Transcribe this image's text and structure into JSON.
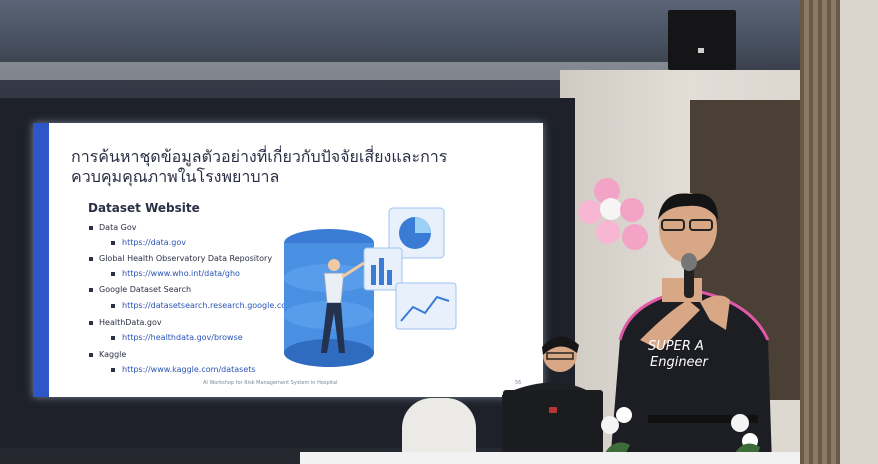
{
  "slide": {
    "title_line1": "การค้นหาชุดข้อมูลตัวอย่างที่เกี่ยวกับปัจจัยเสี่ยงและการ",
    "title_line2": "ควบคุมคุณภาพในโรงพยาบาล",
    "heading": "Dataset Website",
    "items": [
      {
        "name": "Data Gov",
        "url": "https://data.gov"
      },
      {
        "name": "Global Health Observatory Data Repository",
        "url": "https://www.who.int/data/gho"
      },
      {
        "name": "Google Dataset Search",
        "url": "https://datasetsearch.research.google.com"
      },
      {
        "name": "HealthData.gov",
        "url": "https://healthdata.gov/browse"
      },
      {
        "name": "Kaggle",
        "url": "https://www.kaggle.com/datasets"
      }
    ],
    "footer": "AI Workshop for Risk Management System in Hospital",
    "page_number": "56"
  },
  "shirt_text": {
    "line1": "SUPER A",
    "line2": "Engineer"
  },
  "colors": {
    "slide_accent": "#2d57c6",
    "link_blue": "#2a54b8",
    "shirt": "#1d1e24",
    "shirt_trim": "#e058a6"
  }
}
